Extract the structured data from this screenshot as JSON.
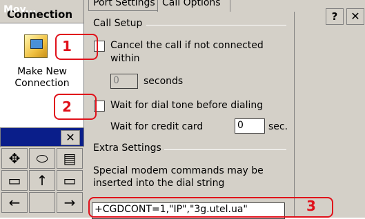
{
  "background_window": {
    "title": "Connection",
    "shortcut_label_line1": "Make New",
    "shortcut_label_line2": "Connection"
  },
  "input_panel": {
    "title": "Mov...",
    "close_glyph": "✕",
    "cells": [
      "✥",
      "⬭",
      "▤",
      "▭",
      "↑",
      "▭",
      "←",
      "",
      "→",
      "",
      "",
      ""
    ]
  },
  "dialog": {
    "tabs": [
      "Port Settings",
      "Call Options"
    ],
    "help_label": "?",
    "close_label": "✕"
  },
  "call_setup": {
    "heading": "Call Setup",
    "cancel_label_line1": "Cancel the call if not connected",
    "cancel_label_line2": "within",
    "cancel_checked": false,
    "seconds_value": "0",
    "seconds_label": "seconds",
    "wait_dial_label": "Wait for dial tone before dialing",
    "wait_dial_checked": false,
    "credit_label": "Wait for credit card",
    "credit_value": "0",
    "credit_unit": "sec."
  },
  "extra_settings": {
    "heading": "Extra Settings",
    "hint_line1": "Special modem commands may be",
    "hint_line2": "inserted into the dial string",
    "modem_command": "+CGDCONT=1,\"IP\",\"3g.utel.ua\""
  },
  "annotations": [
    "1",
    "2",
    "3"
  ],
  "colors": {
    "annotation": "#e0101a",
    "titlebar": "#0a1e8a",
    "dialog_face": "#d4d0c8"
  }
}
